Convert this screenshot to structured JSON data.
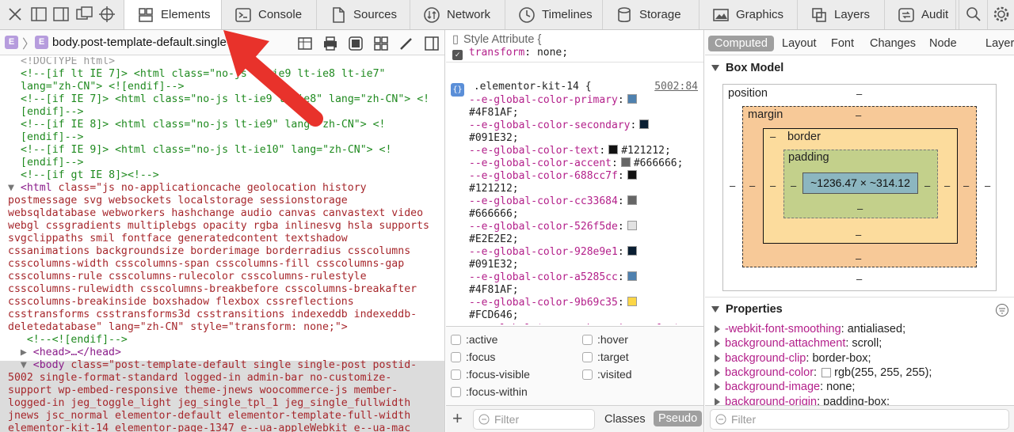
{
  "toolbar": {
    "tabs": [
      {
        "label": "Elements",
        "icon": "elements-icon",
        "selected": true
      },
      {
        "label": "Console",
        "icon": "console-icon"
      },
      {
        "label": "Sources",
        "icon": "sources-icon"
      },
      {
        "label": "Network",
        "icon": "network-icon"
      },
      {
        "label": "Timelines",
        "icon": "timelines-icon"
      },
      {
        "label": "Storage",
        "icon": "storage-icon"
      },
      {
        "label": "Graphics",
        "icon": "graphics-icon"
      },
      {
        "label": "Layers",
        "icon": "layers-icon"
      },
      {
        "label": "Audit",
        "icon": "audit-icon"
      }
    ]
  },
  "breadcrumb": {
    "first_badge": "E",
    "badge": "E",
    "text": "body.post-template-default.single-post"
  },
  "dom": {
    "lines": [
      [
        [
          "gr",
          "<!DOCTYPE html>"
        ]
      ],
      [
        [
          "cm",
          "<!--[if lt IE 7]> <html class=\"no-js lt-ie9 lt-ie8 lt-ie7\""
        ]
      ],
      [
        [
          "cm",
          "lang=\"zh-CN\"> <![endif]-->"
        ]
      ],
      [
        [
          "cm",
          "<!--[if IE 7]> <html class=\"no-js lt-ie9 lt-ie8\" lang=\"zh-CN\"> <!"
        ]
      ],
      [
        [
          "cm",
          "[endif]-->"
        ]
      ],
      [
        [
          "cm",
          "<!--[if IE 8]> <html class=\"no-js lt-ie9\" lang=\"zh-CN\"> <!"
        ]
      ],
      [
        [
          "cm",
          "[endif]-->"
        ]
      ],
      [
        [
          "cm",
          "<!--[if IE 9]> <html class=\"no-js lt-ie10\" lang=\"zh-CN\"> <!"
        ]
      ],
      [
        [
          "cm",
          "[endif]-->"
        ]
      ],
      [
        [
          "cm",
          "<!--[if gt IE 8]><!-->"
        ]
      ],
      [
        [
          "tri",
          "▼ "
        ],
        [
          "tg",
          "<html "
        ],
        [
          "at",
          "class=\"js no-applicationcache geolocation history"
        ]
      ],
      [
        [
          "at",
          "postmessage svg websockets localstorage sessionstorage"
        ]
      ],
      [
        [
          "at",
          "websqldatabase webworkers hashchange audio canvas canvastext video"
        ]
      ],
      [
        [
          "at",
          "webgl cssgradients multiplebgs opacity rgba inlinesvg hsla supports"
        ]
      ],
      [
        [
          "at",
          "svgclippaths smil fontface generatedcontent textshadow"
        ]
      ],
      [
        [
          "at",
          "cssanimations backgroundsize borderimage borderradius csscolumns"
        ]
      ],
      [
        [
          "at",
          "csscolumns-width csscolumns-span csscolumns-fill csscolumns-gap"
        ]
      ],
      [
        [
          "at",
          "csscolumns-rule csscolumns-rulecolor csscolumns-rulestyle"
        ]
      ],
      [
        [
          "at",
          "csscolumns-rulewidth csscolumns-breakbefore csscolumns-breakafter"
        ]
      ],
      [
        [
          "at",
          "csscolumns-breakinside boxshadow flexbox cssreflections"
        ]
      ],
      [
        [
          "at",
          "csstransforms csstransforms3d csstransitions indexeddb indexeddb-"
        ]
      ],
      [
        [
          "at",
          "deletedatabase\" lang=\"zh-CN\" style=\"transform: none;\">"
        ],
        [
          "tg",
          ""
        ]
      ],
      [
        [
          "cm",
          "   <!--<![endif]-->"
        ]
      ],
      [
        [
          "tri",
          "  ▶ "
        ],
        [
          "tg",
          "<head>…</head>"
        ]
      ],
      [
        [
          "tri",
          "  ▼ "
        ],
        [
          "tg",
          "<body "
        ],
        [
          "at",
          "class=\"post-template-default single single-post postid-"
        ]
      ],
      [
        [
          "at",
          "5002 single-format-standard logged-in admin-bar no-customize-"
        ]
      ],
      [
        [
          "at",
          "support wp-embed-responsive theme-jnews woocommerce-js member-"
        ]
      ],
      [
        [
          "at",
          "logged-in jeg_toggle_light jeg_single_tpl_1 jeg_single_fullwidth"
        ]
      ],
      [
        [
          "at",
          "jnews jsc_normal elementor-default elementor-template-full-width"
        ]
      ],
      [
        [
          "at",
          "elementor-kit-14 elementor-page-1347 e--ua-appleWebkit e--ua-mac"
        ]
      ]
    ]
  },
  "styles": {
    "style_attr_header": "Style Attribute {",
    "style_attr_prop": "transform",
    "style_attr_val": "none;",
    "rule_selector": ".elementor-kit-14 {",
    "rule_source": "5002:84",
    "vars": [
      {
        "name": "--e-global-color-primary",
        "value": "#4F81AF",
        "color": "#4F81AF",
        "wrap": true
      },
      {
        "name": "--e-global-color-secondary",
        "value": "#091E32",
        "color": "#091E32",
        "wrap": true
      },
      {
        "name": "--e-global-color-text",
        "value": "#121212",
        "color": "#121212",
        "wrap": false
      },
      {
        "name": "--e-global-color-accent",
        "value": "#666666",
        "color": "#666666",
        "wrap": false
      },
      {
        "name": "--e-global-color-688cc7f",
        "value": "#121212",
        "color": "#121212",
        "wrap": true
      },
      {
        "name": "--e-global-color-cc33684",
        "value": "#666666",
        "color": "#666666",
        "wrap": true
      },
      {
        "name": "--e-global-color-526f5de",
        "value": "#E2E2E2",
        "color": "#E2E2E2",
        "wrap": true
      },
      {
        "name": "--e-global-color-928e9e1",
        "value": "#091E32",
        "color": "#091E32",
        "wrap": true
      },
      {
        "name": "--e-global-color-a5285cc",
        "value": "#4F81AF",
        "color": "#4F81AF",
        "wrap": true
      },
      {
        "name": "--e-global-color-9b69c35",
        "value": "#FCD646",
        "color": "#FCD646",
        "wrap": true
      }
    ],
    "cut_line": "--e-global-typography-primary-font"
  },
  "pseudo_states": [
    ":active",
    ":hover",
    ":focus",
    ":target",
    ":focus-visible",
    ":visited",
    ":focus-within"
  ],
  "mid_footer": {
    "add": "+",
    "filter": "Filter",
    "classes": "Classes",
    "pseudo": "Pseudo"
  },
  "sidebar_tabs": [
    "Computed",
    "Layout",
    "Font",
    "Changes",
    "Node",
    "Layers"
  ],
  "box_model": {
    "title": "Box Model",
    "position": "position",
    "margin": "margin",
    "border": "border",
    "padding": "padding",
    "content": "~1236.47 × ~314.12",
    "dash": "–"
  },
  "properties": {
    "title": "Properties",
    "items": [
      {
        "name": "-webkit-font-smoothing",
        "value": "antialiased;"
      },
      {
        "name": "background-attachment",
        "value": "scroll;"
      },
      {
        "name": "background-clip",
        "value": "border-box;"
      },
      {
        "name": "background-color",
        "value": "rgb(255, 255, 255);",
        "swatch": "#ffffff"
      },
      {
        "name": "background-image",
        "value": "none;"
      },
      {
        "name": "background-origin",
        "value": "padding-box;"
      }
    ]
  },
  "right_footer": {
    "filter": "Filter"
  },
  "colors": {
    "annotation_arrow": "#e8322b",
    "badge": "#b69cdd"
  }
}
